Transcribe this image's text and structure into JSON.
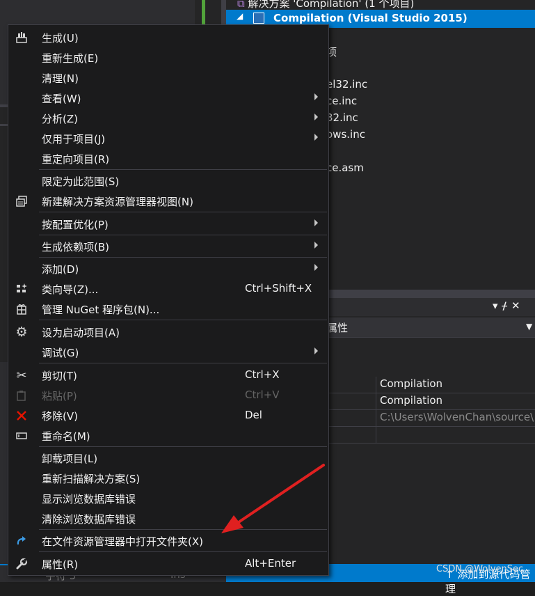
{
  "solution_explorer": {
    "solution_row": "解决方案 'Compilation' (1 个项目)",
    "project_row": "Compilation (Visual Studio 2015)",
    "partial_items": [
      "项",
      "el32.inc",
      "ce.inc",
      "32.inc",
      "ows.inc",
      "ce.asm"
    ]
  },
  "properties_panel": {
    "combo_text": "属性",
    "rows": [
      "Compilation",
      "Compilation",
      "C:\\Users\\WolvenChan\\source\\"
    ]
  },
  "status_bar": {
    "left_text1": "字符 5",
    "left_text2": "Ins",
    "right_text": "添加到源代码管理"
  },
  "watermark": "CSDN @WolvenSec",
  "menu": {
    "build": {
      "label": "生成(U)"
    },
    "rebuild": {
      "label": "重新生成(E)"
    },
    "clean": {
      "label": "清理(N)"
    },
    "view": {
      "label": "查看(W)"
    },
    "analyze": {
      "label": "分析(Z)"
    },
    "project_only": {
      "label": "仅用于项目(J)"
    },
    "retarget": {
      "label": "重定向项目(R)"
    },
    "scope": {
      "label": "限定为此范围(S)"
    },
    "new_view": {
      "label": "新建解决方案资源管理器视图(N)"
    },
    "pgo": {
      "label": "按配置优化(P)"
    },
    "build_deps": {
      "label": "生成依赖项(B)"
    },
    "add": {
      "label": "添加(D)"
    },
    "class_wizard": {
      "label": "类向导(Z)...",
      "shortcut": "Ctrl+Shift+X"
    },
    "nuget": {
      "label": "管理 NuGet 程序包(N)..."
    },
    "startup": {
      "label": "设为启动项目(A)"
    },
    "debug": {
      "label": "调试(G)"
    },
    "cut": {
      "label": "剪切(T)",
      "shortcut": "Ctrl+X"
    },
    "paste": {
      "label": "粘贴(P)",
      "shortcut": "Ctrl+V"
    },
    "remove": {
      "label": "移除(V)",
      "shortcut": "Del"
    },
    "rename": {
      "label": "重命名(M)"
    },
    "unload": {
      "label": "卸载项目(L)"
    },
    "rescan": {
      "label": "重新扫描解决方案(S)"
    },
    "show_db_errors": {
      "label": "显示浏览数据库错误"
    },
    "clear_db_errors": {
      "label": "清除浏览数据库错误"
    },
    "open_folder": {
      "label": "在文件资源管理器中打开文件夹(X)"
    },
    "properties": {
      "label": "属性(R)",
      "shortcut": "Alt+Enter"
    }
  },
  "colors": {
    "accent": "#007acc",
    "menu_bg": "#1b1b1c",
    "remove_icon": "#e51400",
    "open_folder_icon": "#3c9ce6",
    "annotation_arrow": "#e02020"
  }
}
